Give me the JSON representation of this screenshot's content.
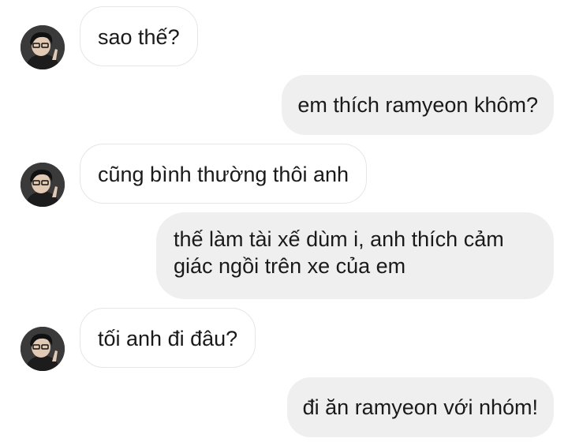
{
  "conversation": {
    "messages": [
      {
        "from": "contact",
        "text": "sao thế?"
      },
      {
        "from": "me",
        "text": "em thích ramyeon khôm?"
      },
      {
        "from": "contact",
        "text": "cũng bình thường thôi anh"
      },
      {
        "from": "me",
        "text": "thế làm tài xế dùm i, anh thích cảm giác ngồi trên xe của em"
      },
      {
        "from": "contact",
        "text": "tối anh đi đâu?"
      },
      {
        "from": "me",
        "text": "đi ăn ramyeon với nhóm!"
      }
    ]
  },
  "colors": {
    "incoming_bubble": "#ffffff",
    "incoming_border": "#e6e6e6",
    "outgoing_bubble": "#efefef",
    "text": "#1a1a1a"
  },
  "icons": {
    "avatar": "contact-avatar-photo"
  }
}
